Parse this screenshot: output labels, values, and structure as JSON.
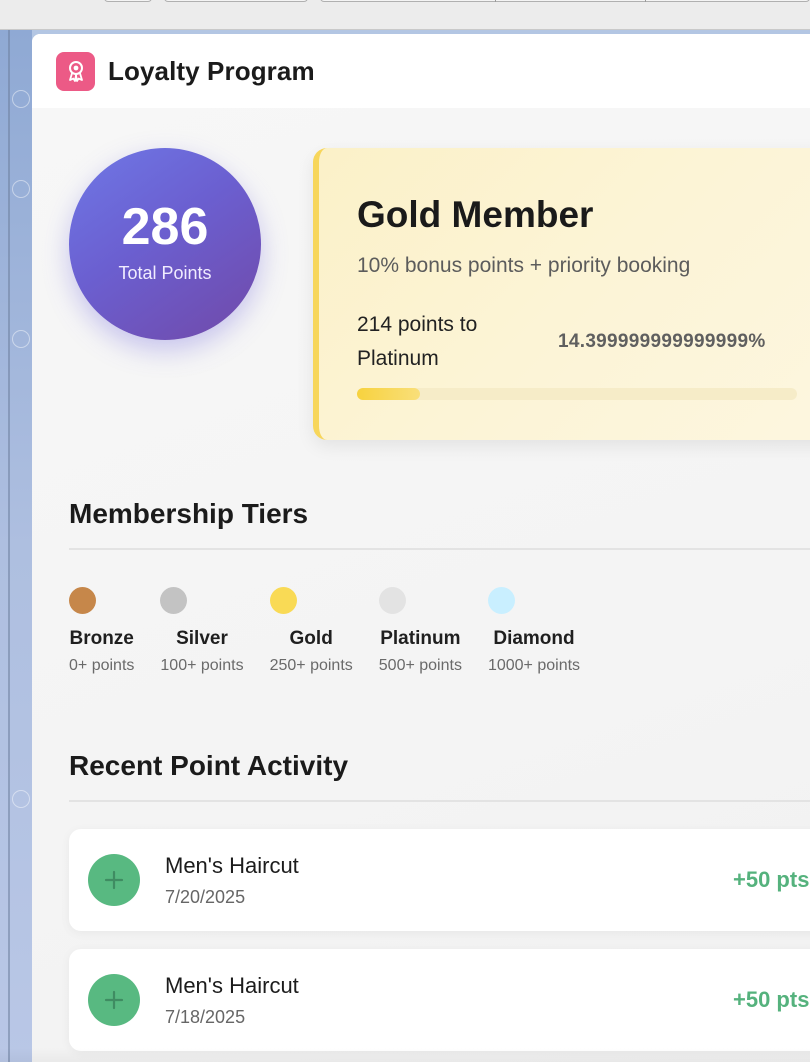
{
  "app": {
    "title": "Loyalty Program",
    "icon": "award-ribbon-icon",
    "accent_color": "#ec5a86"
  },
  "points": {
    "total": "286",
    "label": "Total Points"
  },
  "current_tier": {
    "name": "Gold Member",
    "benefit": "10% bonus points + priority booking",
    "next_tier_text": "214 points to Platinum",
    "progress_text": "14.399999999999999%",
    "progress_fraction": 0.144,
    "accent_color": "#f7d65b"
  },
  "tiers_section": {
    "title": "Membership Tiers",
    "tiers": [
      {
        "name": "Bronze",
        "requirement": "0+ points",
        "color": "#c6874a"
      },
      {
        "name": "Silver",
        "requirement": "100+ points",
        "color": "#c3c3c3"
      },
      {
        "name": "Gold",
        "requirement": "250+ points",
        "color": "#f9da55"
      },
      {
        "name": "Platinum",
        "requirement": "500+ points",
        "color": "#e3e3e3"
      },
      {
        "name": "Diamond",
        "requirement": "1000+ points",
        "color": "#c9efff"
      }
    ]
  },
  "activity_section": {
    "title": "Recent Point Activity",
    "items": [
      {
        "name": "Men's Haircut",
        "date": "7/20/2025",
        "points": "+50 pts",
        "icon": "plus-icon"
      },
      {
        "name": "Men's Haircut",
        "date": "7/18/2025",
        "points": "+50 pts",
        "icon": "plus-icon"
      }
    ]
  }
}
